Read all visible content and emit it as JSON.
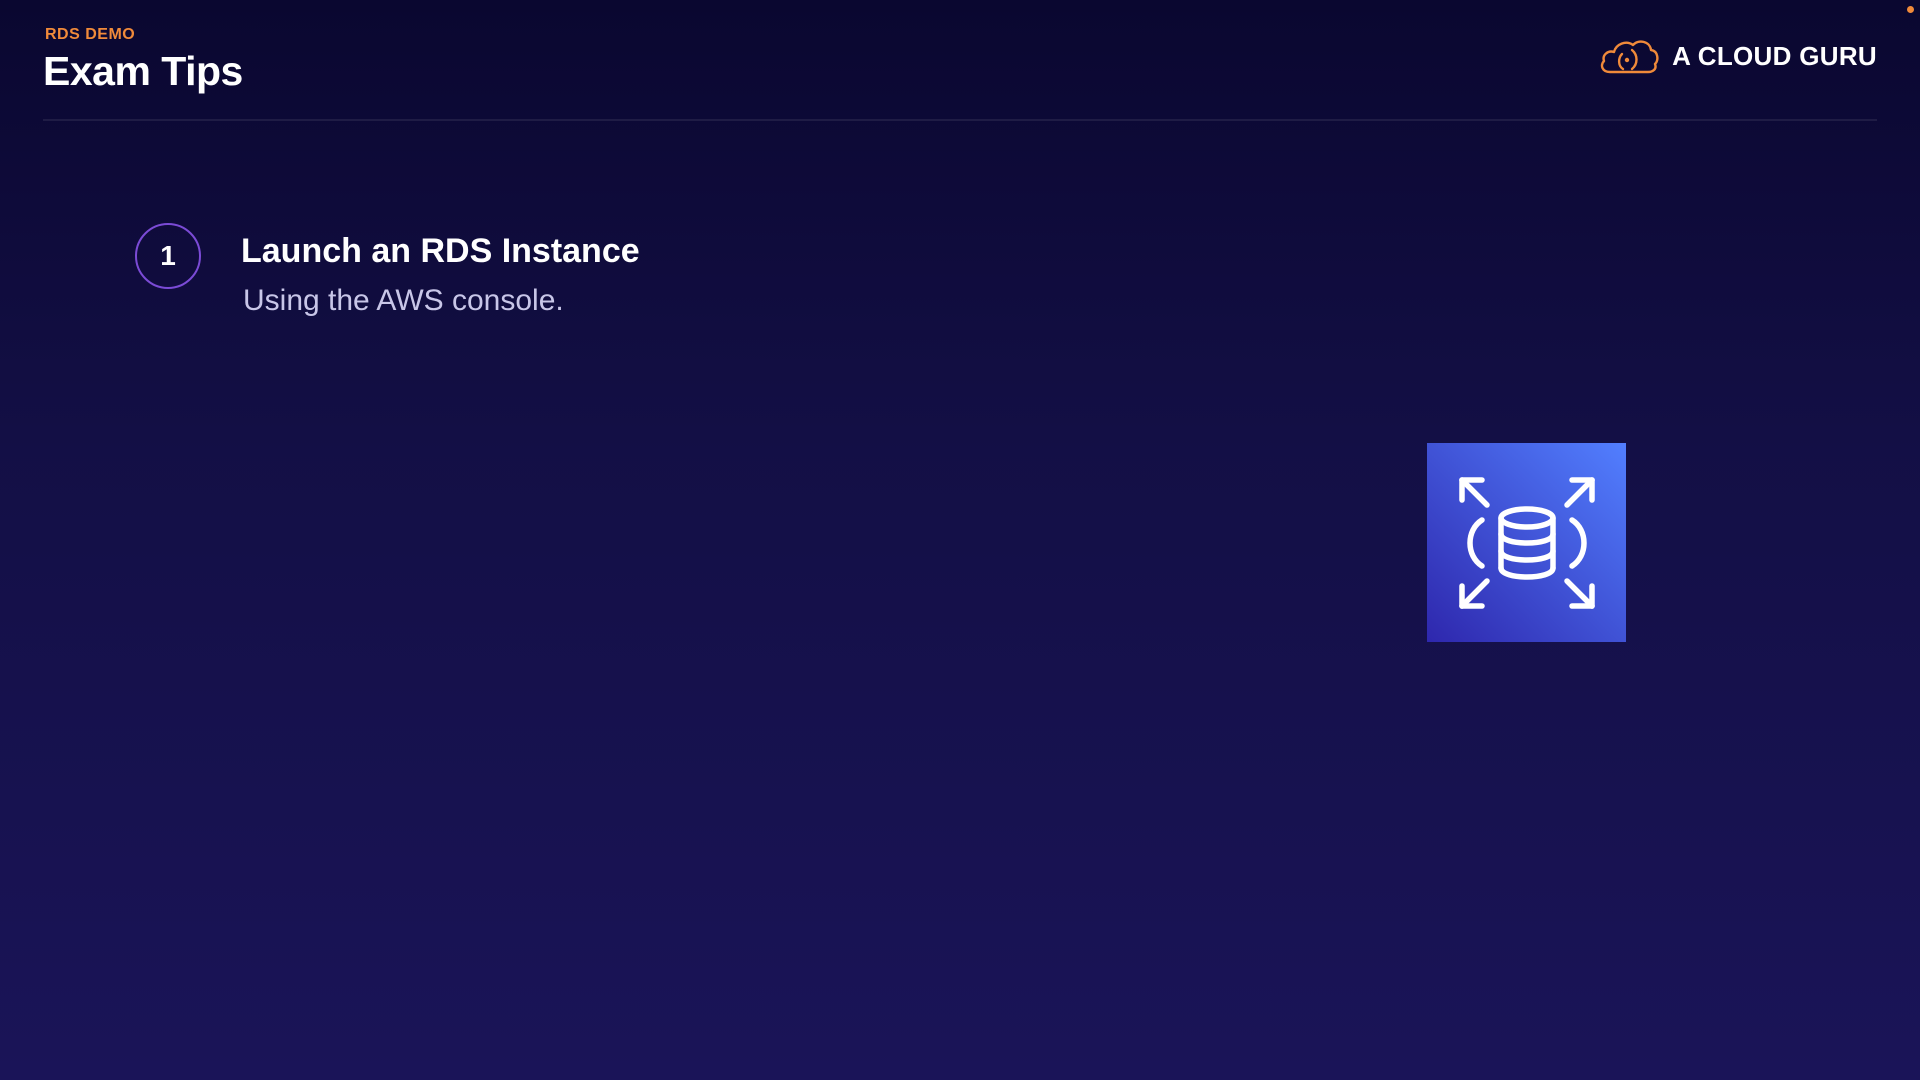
{
  "header": {
    "eyebrow": "RDS DEMO",
    "title": "Exam Tips"
  },
  "logo": {
    "text": "A CLOUD GURU",
    "icon": "cloud-icon",
    "color": "#f08a3a"
  },
  "tips": [
    {
      "number": "1",
      "title": "Launch an RDS Instance",
      "subtitle": "Using the AWS console."
    }
  ],
  "illustration": {
    "icon": "aws-rds-database-icon",
    "gradient_start": "#2e27ad",
    "gradient_end": "#527fff"
  },
  "colors": {
    "accent": "#f08a3a",
    "circle_border": "#7b4bd6",
    "background_top": "#0a0730",
    "background_bottom": "#1a1458"
  }
}
